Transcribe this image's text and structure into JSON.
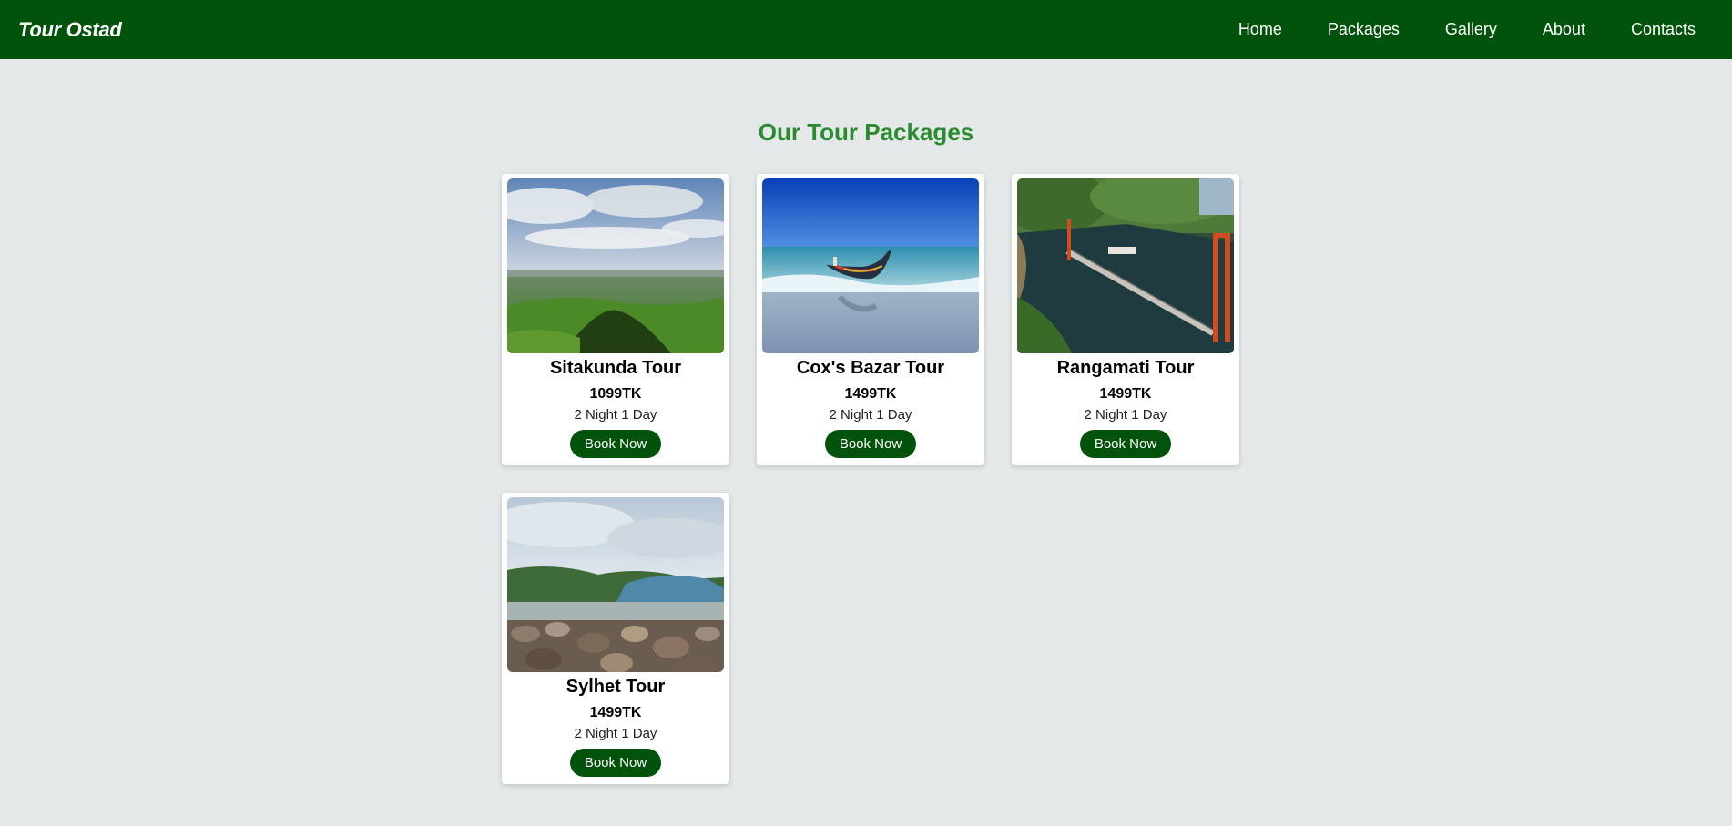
{
  "navbar": {
    "brand": "Tour Ostad",
    "links": [
      "Home",
      "Packages",
      "Gallery",
      "About",
      "Contacts"
    ],
    "background": "#01530b"
  },
  "section": {
    "title": "Our Tour Packages",
    "title_color": "#2b8c2f"
  },
  "packages": [
    {
      "title": "Sitakunda Tour",
      "price": "1099TK",
      "duration": "2 Night 1 Day",
      "button": "Book Now"
    },
    {
      "title": "Cox's Bazar Tour",
      "price": "1499TK",
      "duration": "2 Night 1 Day",
      "button": "Book Now"
    },
    {
      "title": "Rangamati Tour",
      "price": "1499TK",
      "duration": "2 Night 1 Day",
      "button": "Book Now"
    },
    {
      "title": "Sylhet Tour",
      "price": "1499TK",
      "duration": "2 Night 1 Day",
      "button": "Book Now"
    }
  ]
}
